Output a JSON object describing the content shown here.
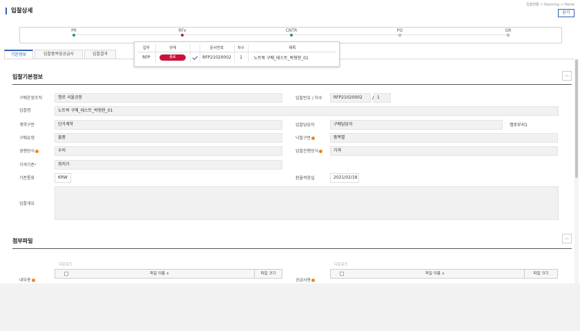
{
  "header": {
    "title": "입찰상세",
    "breadcrumb": "입찰현황 < Sourcing < Home",
    "close_label": "닫기"
  },
  "stepper": {
    "steps": [
      {
        "label": "PR",
        "state": "done"
      },
      {
        "label": "RFx",
        "state": "active"
      },
      {
        "label": "CNTR",
        "state": "done"
      },
      {
        "label": "PO",
        "state": "pending"
      },
      {
        "label": "GR",
        "state": "pending"
      }
    ]
  },
  "popup": {
    "headers": [
      "업무",
      "상태",
      "",
      "문서번호",
      "차수",
      "제목"
    ],
    "row": {
      "task": "RFP",
      "status": "종료",
      "doc_no": "RFP21020002",
      "round": "1",
      "title": "노트북 구매_테스트_박형현_01"
    }
  },
  "tabs": [
    "기본정보",
    "입찰품목및공급사",
    "입찰결과"
  ],
  "basic_info": {
    "section_title": "입찰기본정보",
    "purchase_org_label": "구매운영조직",
    "purchase_org": "엠로 서울공장",
    "bid_no_label": "입찰번호 / 차수",
    "bid_no": "RFP21020002",
    "round_sep": "/",
    "round": "1",
    "bid_name_label": "입찰명",
    "bid_name": "노트북 구매_테스트_박형현_01",
    "contract_type_label": "계약구분",
    "contract_type": "단가계약",
    "manager_label": "입찰담당자",
    "manager": "구매담당자",
    "manager_dept": "엠로부서1",
    "purchase_type_label": "구매유형",
    "purchase_type": "물품",
    "award_type_label": "낙찰구분",
    "award_type": "품목별",
    "competition_label": "경쟁방식",
    "competition": "수의",
    "progress_label": "입찰진행방식",
    "progress": "가격",
    "price_basis_label": "가격기준",
    "price_basis_req": "*",
    "price_basis": "최저가",
    "currency_label": "기준통화",
    "currency": "KRW",
    "fx_date_label": "환율적용일",
    "fx_date": "2021/02/18",
    "overview_label": "입찰개요",
    "overview": ""
  },
  "attachments": {
    "section_title": "첨부파일",
    "download_label": "다운로드",
    "internal_label": "내부용",
    "external_label": "공급사용",
    "file_name_header": "파일 이름 ∧",
    "file_size_header": "파일 크기"
  },
  "icons": {
    "collapse": "chevron-up-icon",
    "info": "info-icon",
    "check": "check-icon"
  },
  "colors": {
    "accent": "#2c5fb3",
    "status_closed": "#c8143c",
    "step_done": "#1a9e4b",
    "info": "#e8871e"
  }
}
